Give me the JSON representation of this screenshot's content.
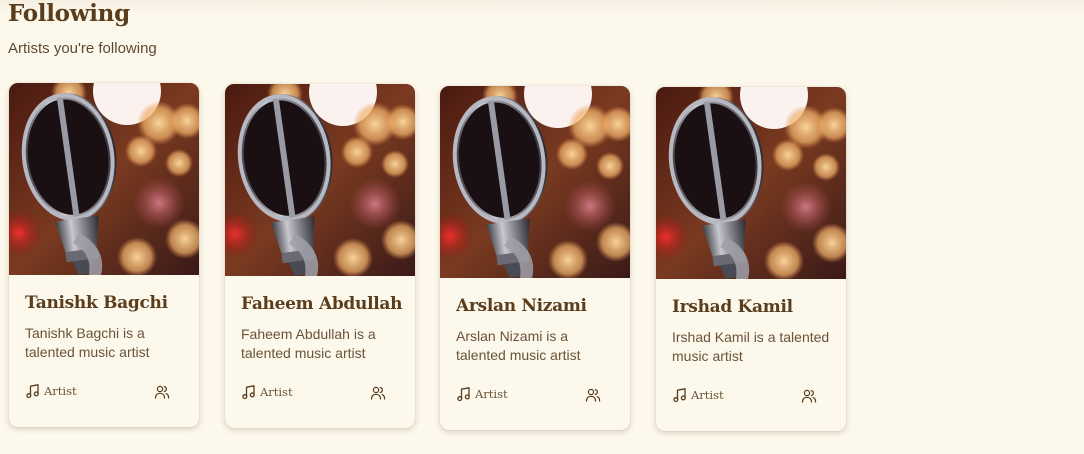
{
  "header": {
    "title": "Following",
    "subtitle": "Artists you're following"
  },
  "artists": [
    {
      "name": "Tanishk Bagchi",
      "description": "Tanishk Bagchi is a talented music artist",
      "tag": "Artist"
    },
    {
      "name": "Faheem Abdullah",
      "description": "Faheem Abdullah is a talented music artist",
      "tag": "Artist"
    },
    {
      "name": "Arslan Nizami",
      "description": "Arslan Nizami is a talented music artist",
      "tag": "Artist"
    },
    {
      "name": "Irshad Kamil",
      "description": "Irshad Kamil is a talented music artist",
      "tag": "Artist"
    }
  ],
  "icons": {
    "tag": "music-note-icon",
    "action": "users-icon"
  },
  "colors": {
    "background": "#fdf8ec",
    "heading": "#5a3d1c",
    "text": "#6a5338"
  }
}
